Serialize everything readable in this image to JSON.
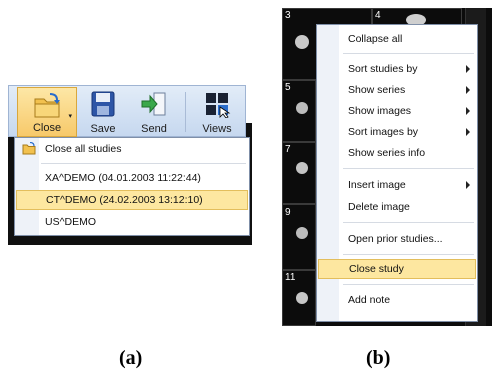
{
  "panel_a": {
    "ribbon": {
      "close_label": "Close",
      "save_label": "Save",
      "send_label": "Send",
      "views_label": "Views"
    },
    "menu": {
      "items": [
        "Close all studies",
        "XA^DEMO (04.01.2003 11:22:44)",
        "CT^DEMO (24.02.2003 13:12:10)",
        "US^DEMO"
      ]
    }
  },
  "panel_b": {
    "viewport_numbers": [
      "3",
      "4",
      "5",
      "7",
      "9",
      "11"
    ],
    "menu": {
      "items": [
        "Collapse all",
        "Sort studies by",
        "Show series",
        "Show images",
        "Sort images by",
        "Show series info",
        "Insert image",
        "Delete image",
        "Open prior studies...",
        "Close study",
        "Add note"
      ]
    }
  },
  "captions": {
    "a": "(a)",
    "b": "(b)"
  },
  "colors": {
    "highlight": "#fde7a0",
    "ribbon": "#c6d8ef"
  }
}
